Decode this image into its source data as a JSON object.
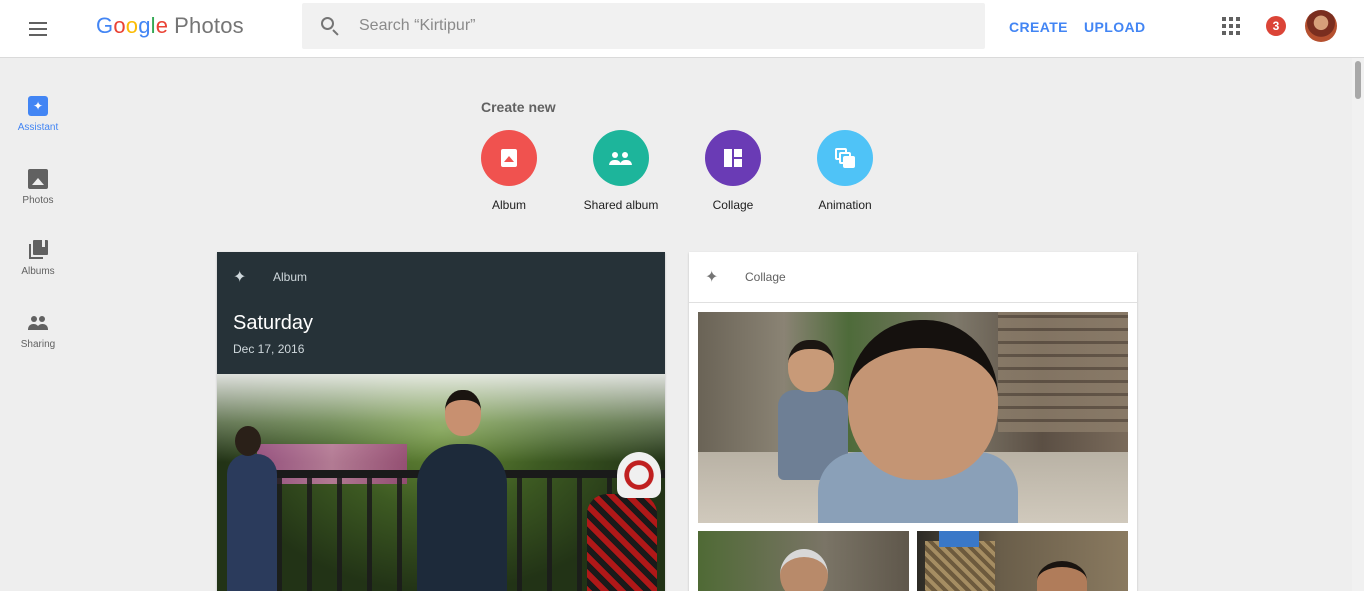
{
  "app": {
    "logo_google": "Google",
    "logo_product": "Photos"
  },
  "header": {
    "search_placeholder": "Search “Kirtipur”",
    "create_label": "CREATE",
    "upload_label": "UPLOAD",
    "notification_count": "3",
    "icons": [
      "menu-icon",
      "search-icon",
      "apps-icon",
      "avatar"
    ]
  },
  "sidebar": {
    "items": [
      {
        "label": "Assistant",
        "icon": "assistant-icon",
        "active": true
      },
      {
        "label": "Photos",
        "icon": "photo-icon",
        "active": false
      },
      {
        "label": "Albums",
        "icon": "albums-icon",
        "active": false
      },
      {
        "label": "Sharing",
        "icon": "people-icon",
        "active": false
      }
    ]
  },
  "create_new": {
    "heading": "Create new",
    "items": [
      {
        "label": "Album",
        "icon": "album-icon",
        "color": "#f0524f"
      },
      {
        "label": "Shared album",
        "icon": "shared-album-icon",
        "color": "#1db59b"
      },
      {
        "label": "Collage",
        "icon": "collage-icon",
        "color": "#6a3bb5"
      },
      {
        "label": "Animation",
        "icon": "animation-icon",
        "color": "#4fc3f7"
      }
    ]
  },
  "cards": {
    "album": {
      "type": "Album",
      "title": "Saturday",
      "date": "Dec 17, 2016"
    },
    "collage": {
      "type": "Collage"
    }
  },
  "colors": {
    "accent": "#4285f4",
    "badge": "#db4437",
    "album_card_header": "#263238"
  }
}
